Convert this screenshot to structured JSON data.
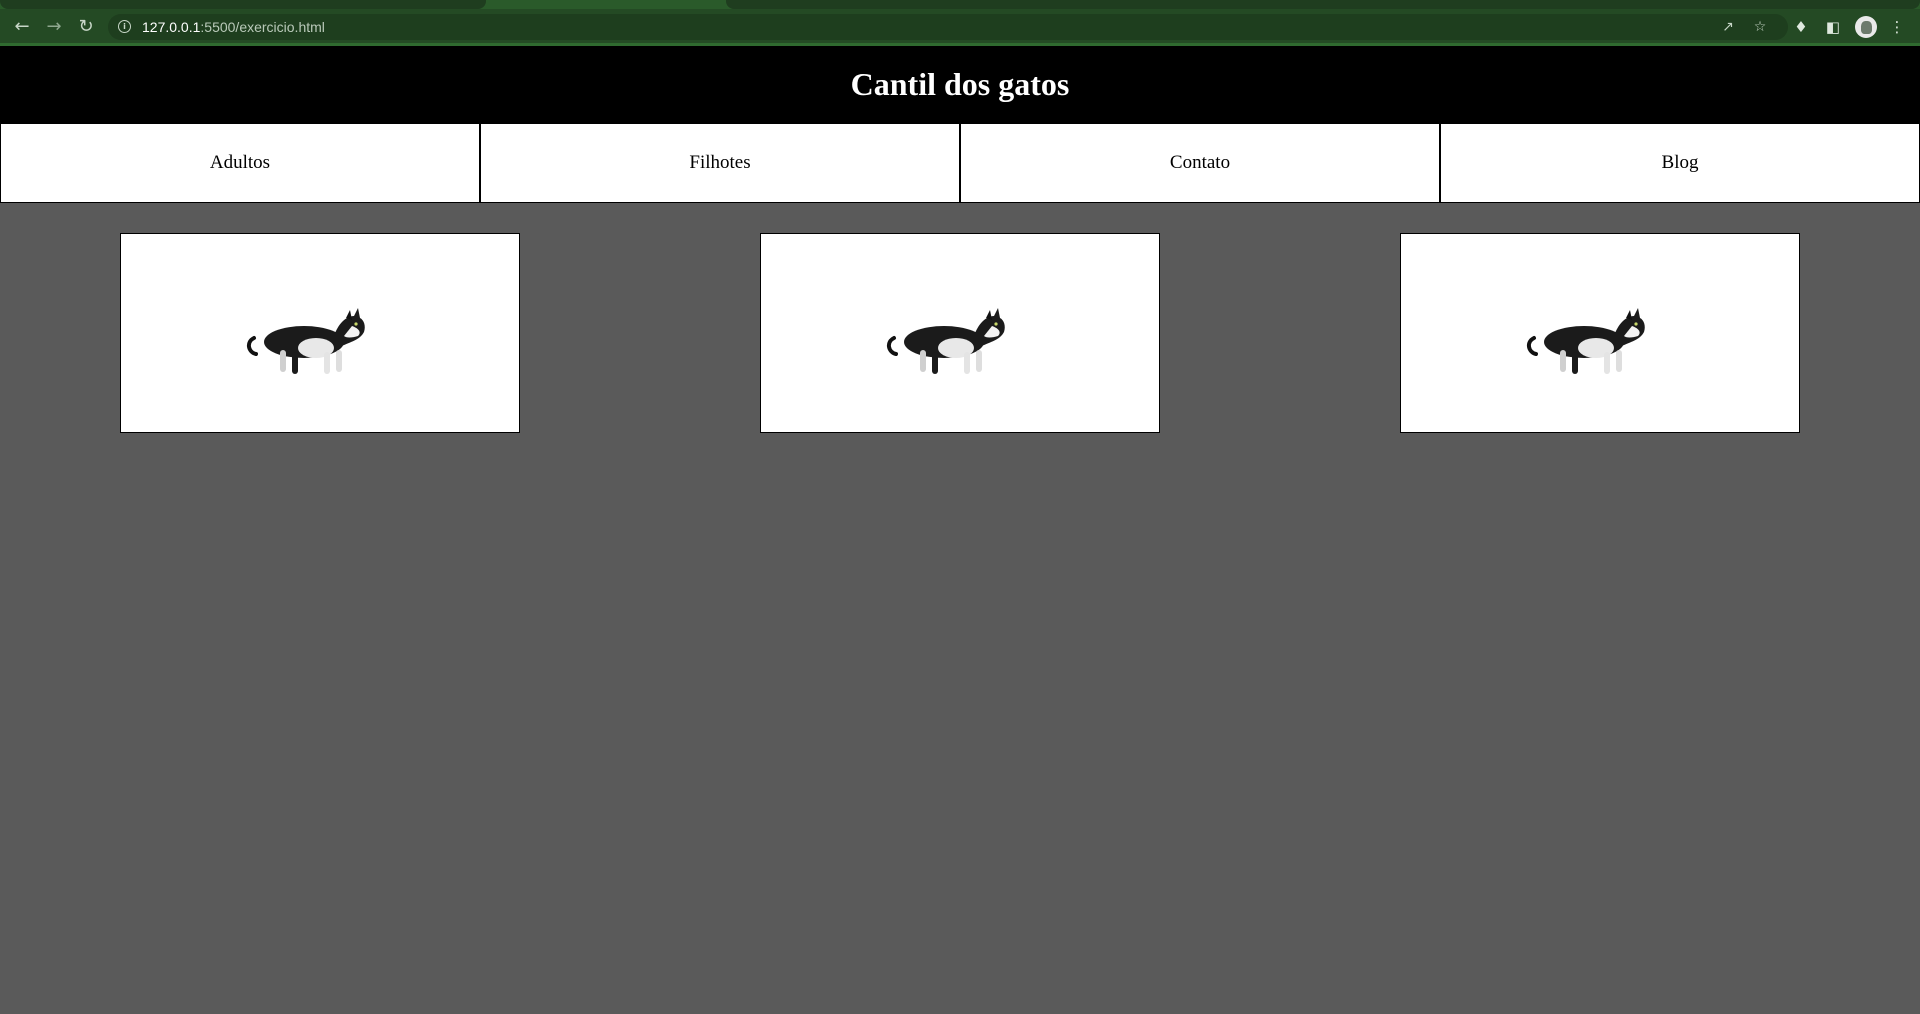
{
  "browser": {
    "url_host": "127.0.0.1",
    "url_path": ":5500/exercicio.html",
    "icons": {
      "back": "back-arrow-icon",
      "forward": "forward-arrow-icon",
      "reload": "reload-icon",
      "info": "info-icon",
      "share": "share-icon",
      "bookmark": "star-icon",
      "extensions": "puzzle-icon",
      "side_panel": "side-panel-icon",
      "profile": "avatar",
      "menu": "kebab-menu-icon"
    },
    "theme_color": "#244a24"
  },
  "header": {
    "title": "Cantil dos gatos",
    "background": "#000000"
  },
  "nav": {
    "items": [
      {
        "label": "Adultos"
      },
      {
        "label": "Filhotes"
      },
      {
        "label": "Contato"
      },
      {
        "label": "Blog"
      }
    ]
  },
  "gallery": {
    "cards": [
      {
        "image": "cat-image"
      },
      {
        "image": "cat-image"
      },
      {
        "image": "cat-image"
      }
    ]
  },
  "page": {
    "background": "#5a5a5a"
  }
}
